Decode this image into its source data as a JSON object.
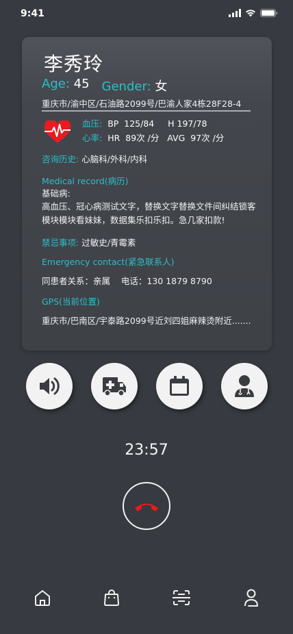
{
  "status_bar": {
    "time": "9:41"
  },
  "patient": {
    "name": "李秀玲",
    "age_label": "Age:",
    "age": "45",
    "gender_label": "Gender:",
    "gender": "女",
    "address": "重庆市/渝中区/石油路2099号/巴渝人家4栋28F28-4"
  },
  "vitals": {
    "bp_label": "血压:",
    "bp_value": "BP  125/84     H 197/78",
    "hr_label": "心率:",
    "hr_value": "HR  89次 /分   AVG  97次 /分"
  },
  "consult": {
    "label": "咨询历史:",
    "value": "心脑科/外科/内科"
  },
  "medical_record": {
    "label": "Medical record(病历)",
    "line1": "基础病:",
    "body": "高血压、冠心病测试文字，替换文字替换文件间纠结锁客模块模块看妹妹，数据集乐扣乐扣。急几家扣款!"
  },
  "contraindications": {
    "label": "禁忌事项:",
    "value": "过敏史/青霉素"
  },
  "emergency_contact": {
    "label": "Emergency contact(紧急联系人)",
    "value": "同患者关系：亲属    电话：130 1879 8790"
  },
  "gps": {
    "label": "GPS(当前位置)",
    "value": "重庆市/巴南区/宇泰路2099号近刘四姐麻辣烫附近......."
  },
  "actions": [
    {
      "icon": "speaker-icon"
    },
    {
      "icon": "ambulance-icon"
    },
    {
      "icon": "calendar-icon"
    },
    {
      "icon": "doctor-icon"
    }
  ],
  "call": {
    "timer": "23:57"
  },
  "tabs": [
    {
      "icon": "home-icon"
    },
    {
      "icon": "bag-icon"
    },
    {
      "icon": "scan-icon"
    },
    {
      "icon": "profile-icon"
    }
  ],
  "colors": {
    "background": "#373a40",
    "accent": "#2bbfc8",
    "hangup": "#e8191c",
    "heart": "#e81b20"
  }
}
